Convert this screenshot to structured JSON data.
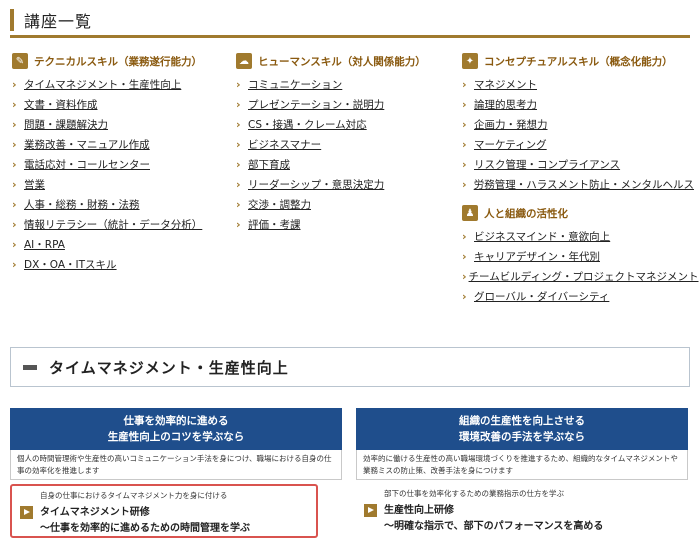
{
  "header": {
    "title": "講座一覧"
  },
  "categories": [
    {
      "title": "テクニカルスキル（業務遂行能力）",
      "icon": "pencil-icon",
      "items": [
        "タイムマネジメント・生産性向上",
        "文書・資料作成",
        "問題・課題解決力",
        "業務改善・マニュアル作成",
        "電話応対・コールセンター",
        "営業",
        "人事・総務・財務・法務",
        "情報リテラシー（統計・データ分析）",
        "AI・RPA",
        "DX・OA・ITスキル"
      ]
    },
    {
      "title": "ヒューマンスキル（対人関係能力）",
      "icon": "chat-bubbles-icon",
      "items": [
        "コミュニケーション",
        "プレゼンテーション・説明力",
        "CS・接遇・クレーム対応",
        "ビジネスマナー",
        "部下育成",
        "リーダーシップ・意思決定力",
        "交渉・調整力",
        "評価・考課"
      ]
    },
    {
      "title": "コンセプチュアルスキル（概念化能力）",
      "icon": "lightbulb-icon",
      "items": [
        "マネジメント",
        "論理的思考力",
        "企画力・発想力",
        "マーケティング",
        "リスク管理・コンプライアンス",
        "労務管理・ハラスメント防止・メンタルヘルス"
      ]
    },
    {
      "title": "人と組織の活性化",
      "icon": "people-icon",
      "items": [
        "ビジネスマインド・意欲向上",
        "キャリアデザイン・年代別",
        "チームビルディング・プロジェクトマネジメント",
        "グローバル・ダイバーシティ"
      ]
    }
  ],
  "section": {
    "title": "タイムマネジメント・生産性向上"
  },
  "features": [
    {
      "line1": "仕事を効率的に進める",
      "line2": "生産性向上のコツを学ぶなら",
      "desc": "個人の時間管理術や生産性の高いコミュニケーション手法を身につけ、職場における自身の仕事の効率化を推進します"
    },
    {
      "line1": "組織の生産性を向上させる",
      "line2": "環境改善の手法を学ぶなら",
      "desc": "効率的に働ける生産性の高い職場環境づくりを推進するため、組織的なタイムマネジメントや業務ミスの防止策、改善手法を身につけます"
    }
  ],
  "courses": [
    {
      "lead": "自身の仕事におけるタイムマネジメント力を身に付ける",
      "title": "タイムマネジメント研修",
      "subtitle": "～仕事を効率的に進めるための時間管理を学ぶ"
    },
    {
      "lead": "部下の仕事を効率化するための業務指示の仕方を学ぶ",
      "title": "生産性向上研修",
      "subtitle": "～明確な指示で、部下のパフォーマンスを高める"
    }
  ],
  "colors": {
    "accent": "#a07a2e",
    "banner": "#1f4e8c",
    "highlight": "#d9534f"
  }
}
